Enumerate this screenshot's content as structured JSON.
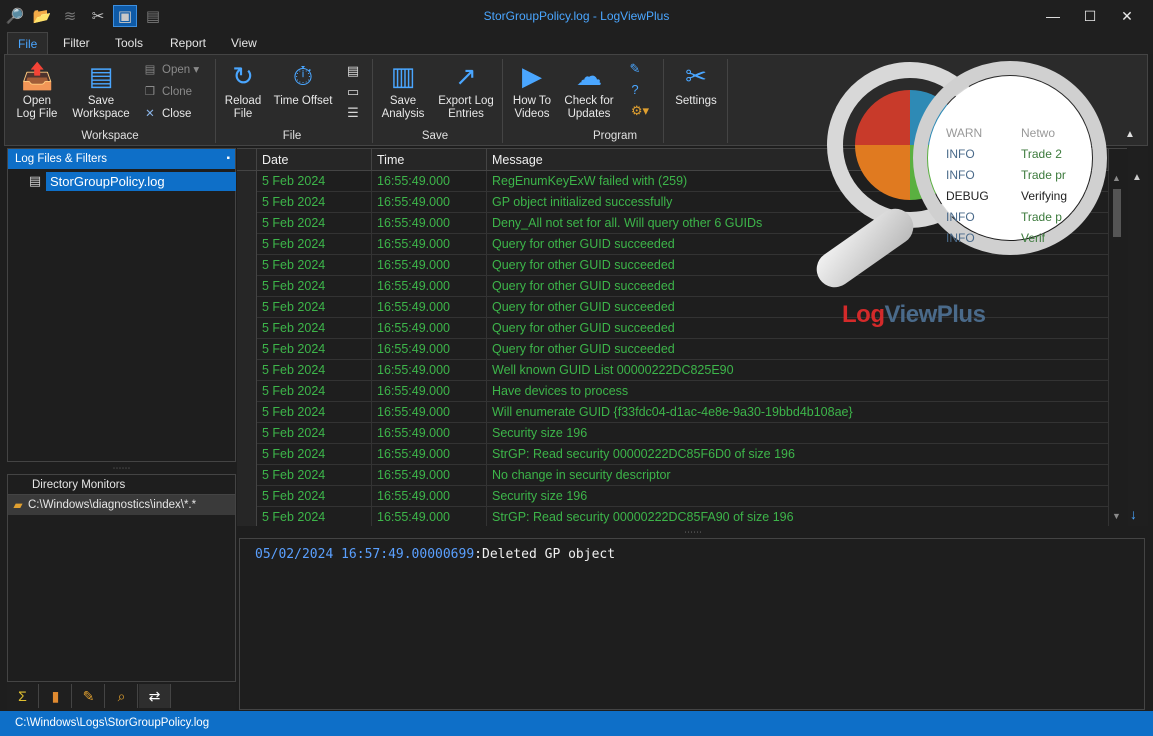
{
  "window": {
    "title": "StorGroupPolicy.log - LogViewPlus",
    "controls": {
      "minimize": "—",
      "maximize": "☐",
      "close": "✕"
    }
  },
  "quick_access": [
    {
      "name": "search-icon",
      "glyph": "🔎"
    },
    {
      "name": "open-folder-icon",
      "glyph": "📂"
    },
    {
      "name": "layers-icon",
      "glyph": "≋"
    },
    {
      "name": "tools-icon",
      "glyph": "✂"
    },
    {
      "name": "workspace-icon",
      "glyph": "▣"
    },
    {
      "name": "document-icon",
      "glyph": "▤"
    }
  ],
  "ribbon_tabs": [
    "File",
    "Filter",
    "Tools",
    "Report",
    "View"
  ],
  "ribbon": {
    "workspace": {
      "label": "Workspace",
      "open_log_file": "Open\nLog File",
      "save_workspace": "Save\nWorkspace",
      "open": "Open",
      "clone": "Clone",
      "close": "Close"
    },
    "file": {
      "label": "File",
      "reload_file": "Reload\nFile",
      "time_offset": "Time Offset"
    },
    "save": {
      "label": "Save",
      "save_analysis": "Save\nAnalysis",
      "export_log_entries": "Export Log\nEntries"
    },
    "program": {
      "label": "Program",
      "how_to_videos": "How To\nVideos",
      "check_for_updates": "Check for\nUpdates",
      "settings": "Settings"
    }
  },
  "left_panel": {
    "title": "Log Files & Filters",
    "file": "StorGroupPolicy.log"
  },
  "directory_monitors": {
    "title": "Directory Monitors",
    "path": "C:\\Windows\\diagnostics\\index\\*.*"
  },
  "grid": {
    "columns": [
      "Date",
      "Time",
      "Message"
    ],
    "rows": [
      [
        "5 Feb 2024",
        "16:55:49.000",
        "RegEnumKeyExW failed with (259)"
      ],
      [
        "5 Feb 2024",
        "16:55:49.000",
        "GP object initialized successfully"
      ],
      [
        "5 Feb 2024",
        "16:55:49.000",
        "Deny_All not set for all. Will query other 6 GUIDs"
      ],
      [
        "5 Feb 2024",
        "16:55:49.000",
        "Query for other GUID succeeded"
      ],
      [
        "5 Feb 2024",
        "16:55:49.000",
        "Query for other GUID succeeded"
      ],
      [
        "5 Feb 2024",
        "16:55:49.000",
        "Query for other GUID succeeded"
      ],
      [
        "5 Feb 2024",
        "16:55:49.000",
        "Query for other GUID succeeded"
      ],
      [
        "5 Feb 2024",
        "16:55:49.000",
        "Query for other GUID succeeded"
      ],
      [
        "5 Feb 2024",
        "16:55:49.000",
        "Query for other GUID succeeded"
      ],
      [
        "5 Feb 2024",
        "16:55:49.000",
        "Well known GUID List 00000222DC825E90"
      ],
      [
        "5 Feb 2024",
        "16:55:49.000",
        "Have devices to process"
      ],
      [
        "5 Feb 2024",
        "16:55:49.000",
        "Will enumerate GUID {f33fdc04-d1ac-4e8e-9a30-19bbd4b108ae}"
      ],
      [
        "5 Feb 2024",
        "16:55:49.000",
        "Security size 196"
      ],
      [
        "5 Feb 2024",
        "16:55:49.000",
        "StrGP: Read security 00000222DC85F6D0 of size 196"
      ],
      [
        "5 Feb 2024",
        "16:55:49.000",
        "No change in security descriptor"
      ],
      [
        "5 Feb 2024",
        "16:55:49.000",
        "Security size 196"
      ],
      [
        "5 Feb 2024",
        "16:55:49.000",
        "StrGP: Read security 00000222DC85FA90 of size 196"
      ]
    ]
  },
  "detail": {
    "date": "05/02/2024",
    "time": "16:57:49.00000699",
    "separator": ":",
    "message": "Deleted GP object"
  },
  "status_bar": {
    "path": "C:\\Windows\\Logs\\StorGroupPolicy.log"
  },
  "logo": {
    "text_a": "Log",
    "text_b": "ViewPlus",
    "lens_rows": [
      [
        "WARN",
        "Netwo"
      ],
      [
        "INFO",
        "Trade 2"
      ],
      [
        "INFO",
        "Trade pr"
      ],
      [
        "DEBUG",
        "Verifying"
      ],
      [
        "INFO",
        "Trade p"
      ],
      [
        "INFO",
        "Verif"
      ]
    ]
  },
  "bottom_icons": [
    "sigma-icon",
    "bookmark-icon",
    "pencil-icon",
    "search-folder-icon",
    "swap-icon"
  ]
}
